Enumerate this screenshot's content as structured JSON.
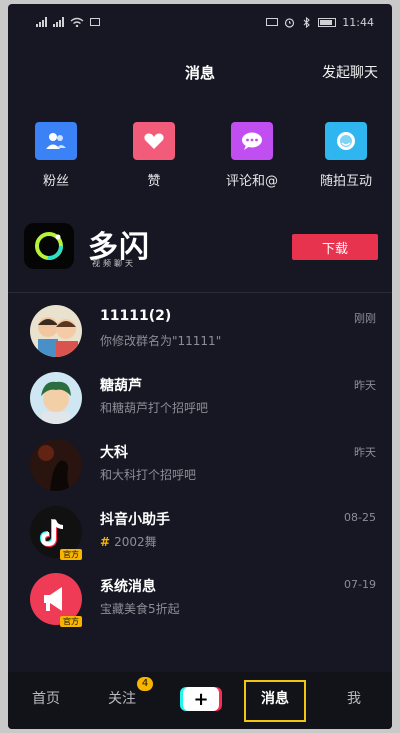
{
  "status": {
    "time": "11:44"
  },
  "header": {
    "title": "消息",
    "start_chat": "发起聊天"
  },
  "quick": [
    {
      "label": "粉丝",
      "icon": "fans-icon",
      "color": "#3a82f6"
    },
    {
      "label": "赞",
      "icon": "heart-icon",
      "color": "#f25b7a"
    },
    {
      "label": "评论和@",
      "icon": "comment-icon",
      "color": "#c04ef0"
    },
    {
      "label": "随拍互动",
      "icon": "camera-interact-icon",
      "color": "#2fb6f0"
    }
  ],
  "promo": {
    "brand": "多闪",
    "subtitle": "视频聊天",
    "button": "下载",
    "button_color": "#e8334f"
  },
  "chats": [
    {
      "name": "11111(2)",
      "preview": "你修改群名为\"11111\"",
      "time": "刚刚"
    },
    {
      "name": "糖葫芦",
      "preview": "和糖葫芦打个招呼吧",
      "time": "昨天"
    },
    {
      "name": "大科",
      "preview": "和大科打个招呼吧",
      "time": "昨天"
    },
    {
      "name": "抖音小助手",
      "preview": "2002舞",
      "time": "08-25",
      "tag": "官方"
    },
    {
      "name": "系统消息",
      "preview": "宝藏美食5折起",
      "time": "07-19",
      "tag": "官方"
    }
  ],
  "tabs": {
    "home": "首页",
    "follow": "关注",
    "follow_badge": "4",
    "create": "+",
    "messages": "消息",
    "me": "我"
  }
}
